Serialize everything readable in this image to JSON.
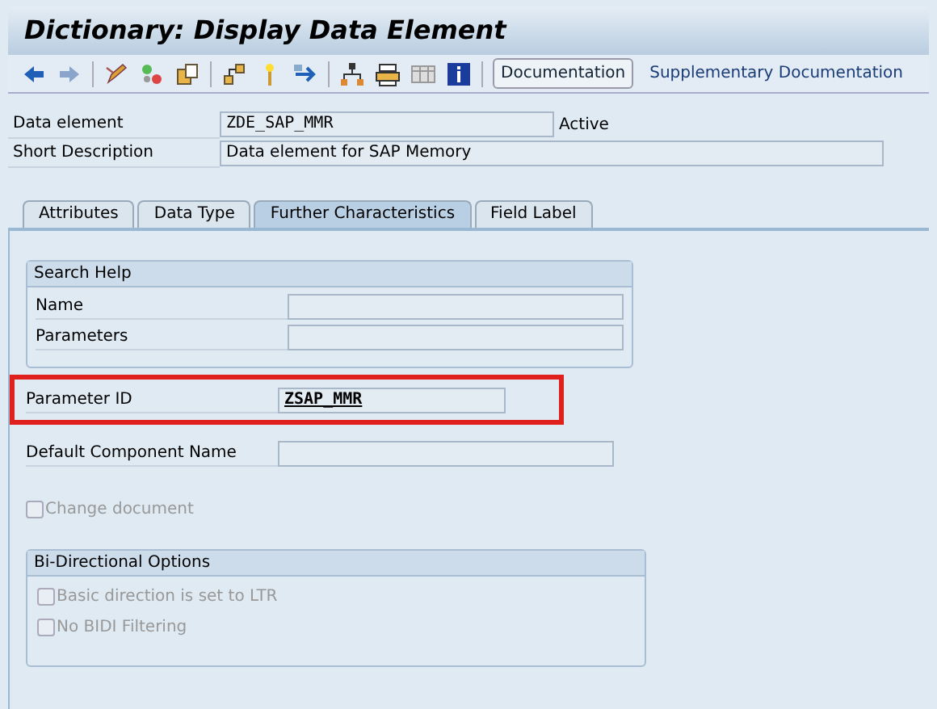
{
  "window": {
    "title": "Dictionary: Display Data Element"
  },
  "toolbar": {
    "icons": [
      {
        "kind": "back"
      },
      {
        "kind": "forward"
      },
      {
        "kind": "sep"
      },
      {
        "kind": "pencil"
      },
      {
        "kind": "activate"
      },
      {
        "kind": "copy"
      },
      {
        "kind": "sep"
      },
      {
        "kind": "where"
      },
      {
        "kind": "torch"
      },
      {
        "kind": "nav"
      },
      {
        "kind": "sep"
      },
      {
        "kind": "tree"
      },
      {
        "kind": "printer"
      },
      {
        "kind": "grid"
      },
      {
        "kind": "info"
      },
      {
        "kind": "sep"
      }
    ],
    "buttons": [
      {
        "label": "Documentation",
        "kind": "button"
      },
      {
        "label": "Supplementary Documentation",
        "kind": "link"
      }
    ]
  },
  "header": {
    "fields": [
      {
        "label": "Data element",
        "value": "ZDE_SAP_MMR",
        "status": "Active",
        "mono": true
      },
      {
        "label": "Short Description",
        "value": "Data element for SAP Memory",
        "mono": false
      }
    ]
  },
  "tabs": [
    {
      "label": "Attributes",
      "selected": false
    },
    {
      "label": "Data Type",
      "selected": false
    },
    {
      "label": "Further Characteristics",
      "selected": true
    },
    {
      "label": "Field Label",
      "selected": false
    }
  ],
  "search_help": {
    "title": "Search Help",
    "fields": [
      {
        "label": "Name"
      },
      {
        "label": "Parameters"
      }
    ]
  },
  "parameter_id": {
    "label": "Parameter ID",
    "value": "ZSAP_MMR",
    "highlighted": true
  },
  "default_component": {
    "label": "Default Component Name"
  },
  "change_document": {
    "label": "Change document",
    "checked": false,
    "disabled": true
  },
  "bidi": {
    "title": "Bi-Directional Options",
    "options": [
      {
        "label": "Basic direction is set to LTR",
        "checked": false,
        "disabled": true
      },
      {
        "label": "No BIDI Filtering",
        "checked": false,
        "disabled": true
      }
    ]
  }
}
